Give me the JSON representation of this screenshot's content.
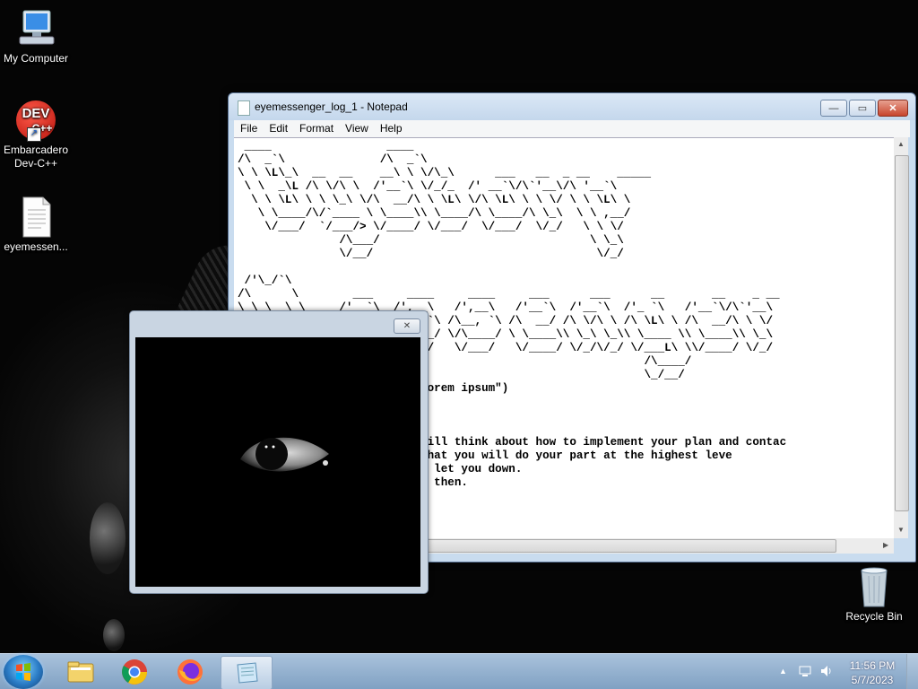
{
  "desktop": {
    "icons": [
      {
        "label": "My Computer",
        "icon": "computer-icon"
      },
      {
        "label": "Embarcadero Dev-C++",
        "line1": "Embarcadero",
        "line2": "Dev-C++",
        "badge": "DEV",
        "badge2": "C++",
        "icon": "devcpp-icon"
      },
      {
        "label": "eyemessen...",
        "icon": "text-file-icon"
      },
      {
        "label": "Recycle Bin",
        "icon": "recycle-bin-icon"
      }
    ]
  },
  "notepad": {
    "title": "eyemessenger_log_1 - Notepad",
    "menu": [
      "File",
      "Edit",
      "Format",
      "View",
      "Help"
    ],
    "content": " ____                 ____\n/\\  _`\\              /\\  _`\\\n\\ \\ \\L\\_\\  __  __    __\\ \\ \\/\\_\\      ___   __  _ __    _____\n \\ \\  _\\L /\\ \\/\\ \\  /'__`\\ \\/_/_  /' __`\\/\\`'__\\/\\ '__`\\\n  \\ \\ \\L\\ \\ \\ \\_\\ \\/\\  __/\\ \\ \\L\\ \\/\\ \\L\\ \\ \\ \\/ \\ \\ \\L\\ \\\n   \\ \\____/\\/`____ \\ \\____\\\\ \\____/\\ \\____/\\ \\_\\  \\ \\ ,__/\n    \\/___/  `/___/> \\/____/ \\/___/  \\/___/  \\/_/   \\ \\ \\/\n               /\\___/                               \\ \\_\\\n               \\/__/                                 \\/_/\n\n /'\\_/`\\\n/\\      \\        ___     ____     ____     ___      ___      __       __    _ __\n\\ \\ \\__\\ \\     /'__`\\  /',__\\   /',__\\   /'__`\\  /'__`\\  /'_ `\\   /'__`\\/\\`'__\\\n \\ \\ \\_/\\ \\   /\\  __/ /\\__, `\\ /\\__, `\\ /\\  __/ /\\ \\/\\ \\ /\\ \\L\\ \\ /\\  __/\\ \\ \\/\n  \\ \\_\\\\ \\_\\  \\ \\____\\\\/\\____/ \\/\\____/ \\ \\____\\\\ \\_\\ \\_\\\\ \\____ \\\\ \\____\\\\ \\_\\\n   \\/_/ \\/_/   \\/____/ \\/___/   \\/___/   \\/____/ \\/_/\\/_/ \\/___L\\ \\\\/____/ \\/_/\n                                                            /\\____/\n                                                            \\_/__/\n                   Cipher(\"lorem ipsum\")\n\n\n\n[Redacted] I understand. I will think about how to implement your plan and contac\n[Unredacted}] Okay. I hope that you will do your part at the highest leve\n[Redacted] No doubt we won't let you down.\n[Unredacted}] See you later, then.",
    "buttons": {
      "minimize": "—",
      "maximize": "▭",
      "close": "✕"
    }
  },
  "eye_window": {
    "close": "✕"
  },
  "taskbar": {
    "apps": [
      {
        "name": "file-explorer-icon"
      },
      {
        "name": "chrome-icon"
      },
      {
        "name": "firefox-icon"
      },
      {
        "name": "notepad-icon"
      }
    ],
    "time": "11:56 PM",
    "date": "5/7/2023"
  }
}
